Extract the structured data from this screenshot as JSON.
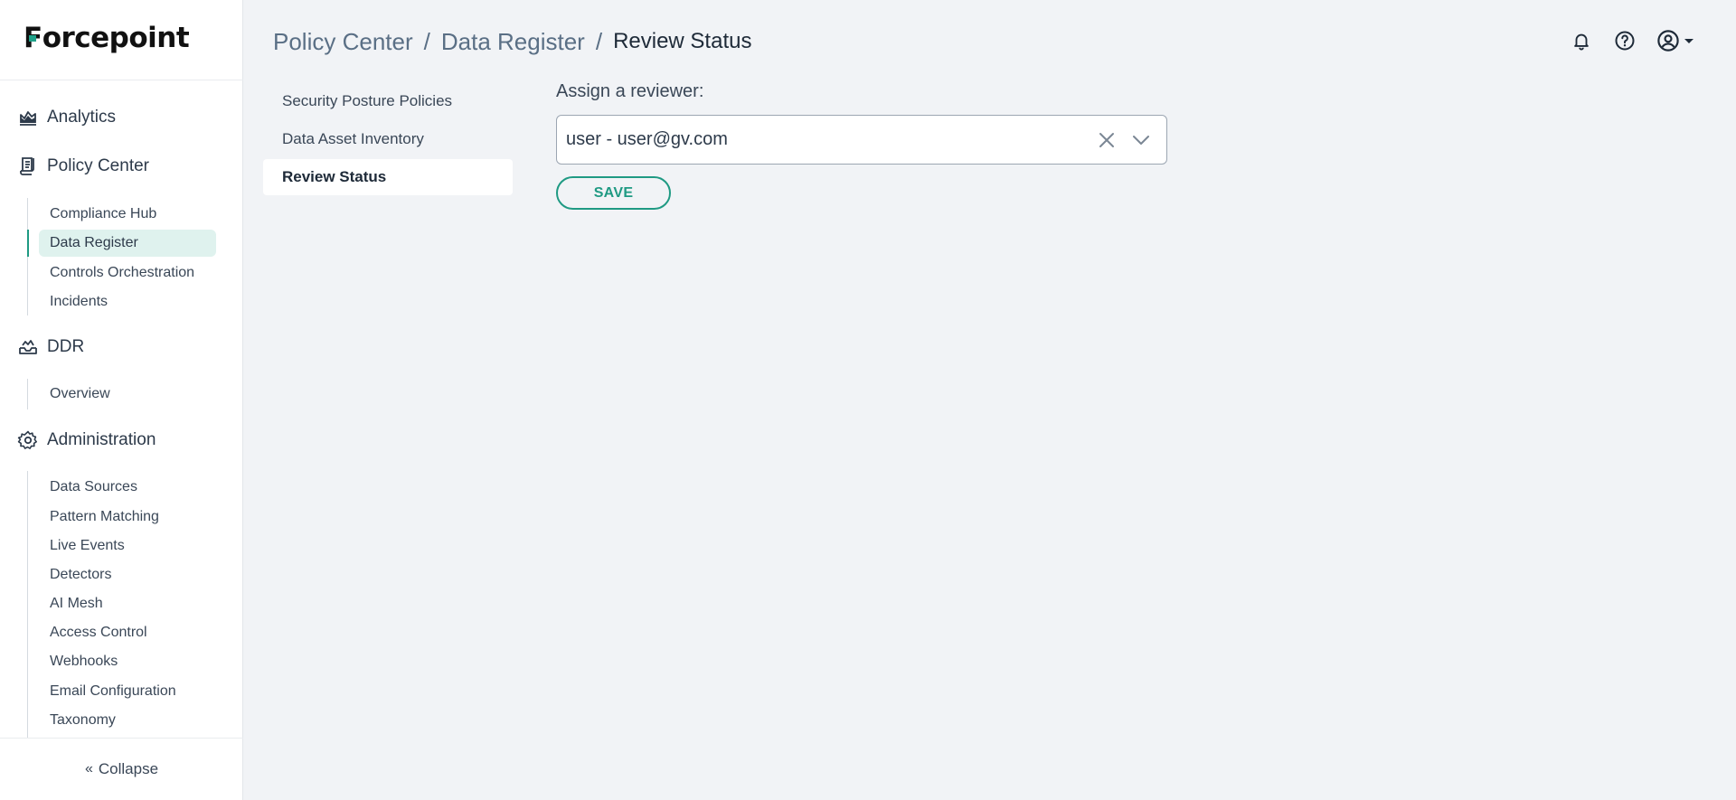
{
  "brand": {
    "logo_text": "orcepoint",
    "logo_letter": "F",
    "accent": "#1f9a83"
  },
  "sidebar": {
    "sections": [
      {
        "label": "Analytics",
        "icon": "chart-icon"
      },
      {
        "label": "Policy Center",
        "icon": "document-icon"
      },
      {
        "label": "DDR",
        "icon": "inbox-icon"
      },
      {
        "label": "Administration",
        "icon": "gear-icon"
      }
    ],
    "policy_items": [
      "Compliance Hub",
      "Data Register",
      "Controls Orchestration",
      "Incidents"
    ],
    "ddr_items": [
      "Overview"
    ],
    "admin_items": [
      "Data Sources",
      "Pattern Matching",
      "Live Events",
      "Detectors",
      "AI Mesh",
      "Access Control",
      "Webhooks",
      "Email Configuration",
      "Taxonomy"
    ],
    "active_item": "Data Register",
    "collapse_label": "Collapse"
  },
  "breadcrumb": {
    "items": [
      "Policy Center",
      "Data Register"
    ],
    "current": "Review Status",
    "separator": "/"
  },
  "subnav": {
    "items": [
      "Security Posture Policies",
      "Data Asset Inventory",
      "Review Status"
    ],
    "active": "Review Status"
  },
  "form": {
    "label": "Assign a reviewer:",
    "selected_value": "user - user@gv.com",
    "save_label": "SAVE"
  }
}
